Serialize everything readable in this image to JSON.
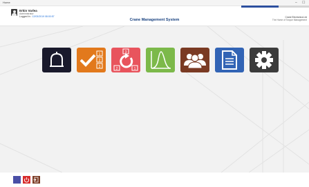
{
  "window": {
    "title": "Home",
    "minimize_glyph": "–",
    "maximize_glyph": "☐"
  },
  "user": {
    "name": "Erkin Varlea",
    "role": "Administrator",
    "logged_in_label": "Logged In :",
    "logged_in_time": "12/03/2019 08:00:57"
  },
  "app": {
    "title": "Crane Management System",
    "progress": 0.55,
    "right_text_1": "Crane Electronics Ltd",
    "right_text_2": "The Home of Torque Management"
  },
  "tiles": [
    {
      "id": "bell",
      "icon": "bell-outline-icon",
      "color": "#1a1a2c"
    },
    {
      "id": "checklist",
      "icon": "checklist-icon",
      "color": "#e2791c",
      "numbers": [
        "1",
        "2",
        "3"
      ]
    },
    {
      "id": "sequence",
      "icon": "refresh-sequence-icon",
      "color": "#e8545d",
      "numbers": [
        "3",
        "2",
        "1"
      ]
    },
    {
      "id": "curve",
      "icon": "distribution-curve-icon",
      "color": "#7cb94a"
    },
    {
      "id": "users",
      "icon": "users-group-icon",
      "color": "#7a3a23"
    },
    {
      "id": "reports",
      "icon": "document-icon",
      "color": "#3264b5"
    },
    {
      "id": "settings",
      "icon": "gear-icon",
      "color": "#3c3c3c"
    }
  ],
  "footer": [
    {
      "id": "blank",
      "icon": "blank-tile-icon",
      "color": "#4a4fa6"
    },
    {
      "id": "power",
      "icon": "power-icon",
      "color": "#d72b2b"
    },
    {
      "id": "exit",
      "icon": "exit-door-icon",
      "color": "#7a3a23"
    }
  ]
}
